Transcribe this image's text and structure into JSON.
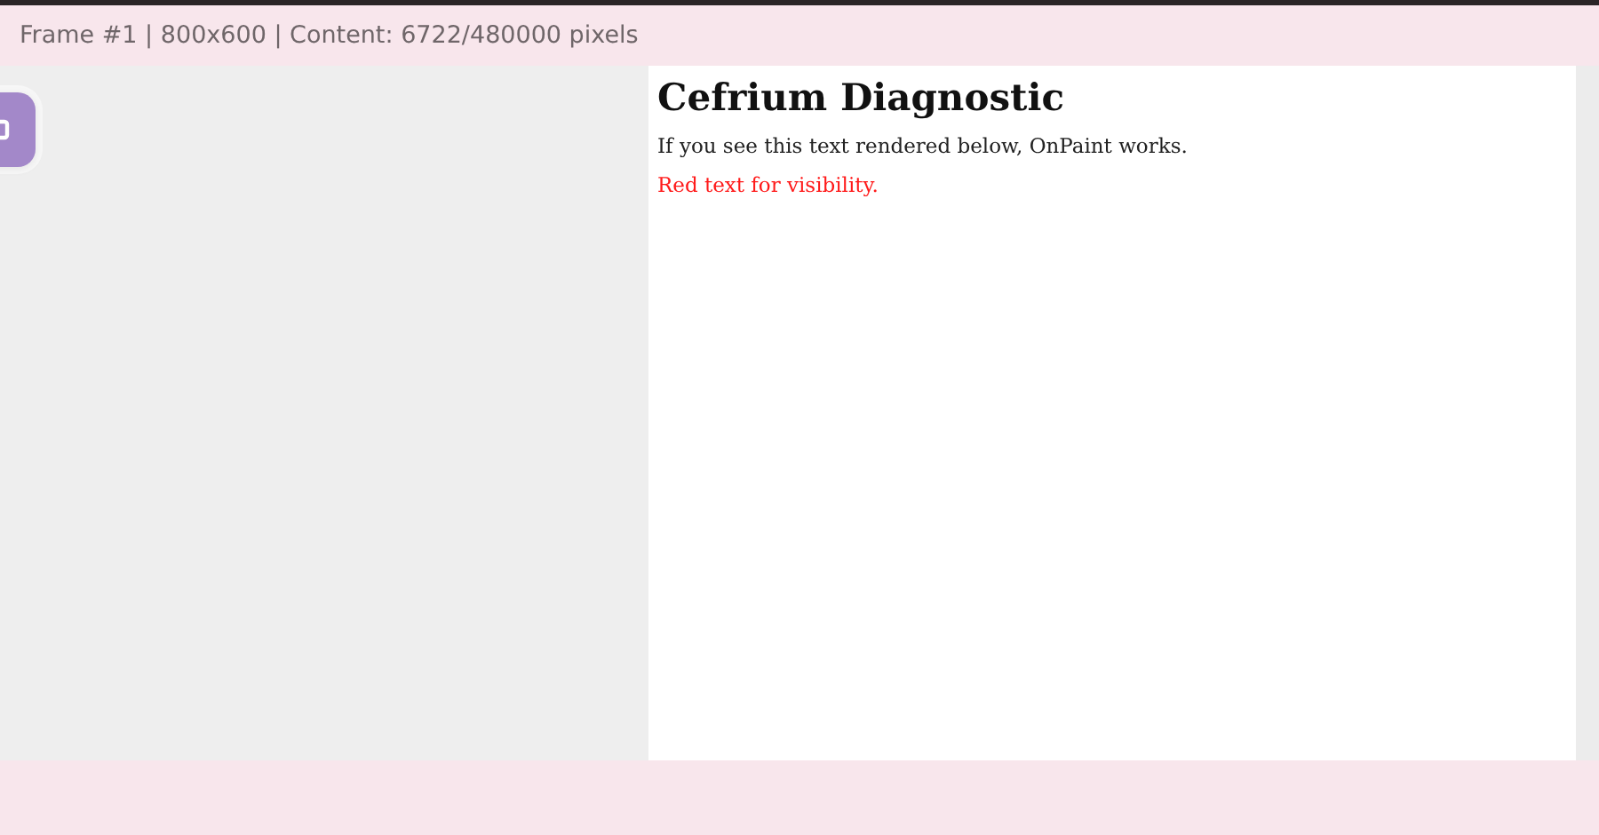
{
  "status_line": "Frame #1 | 800x600 | Content: 6722/480000 pixels",
  "document": {
    "heading": "Cefrium Diagnostic",
    "paragraphs": [
      {
        "kind": "plain",
        "text": "If you see this text rendered below, OnPaint works."
      },
      {
        "kind": "alert",
        "text": "Red text for visibility."
      }
    ]
  }
}
